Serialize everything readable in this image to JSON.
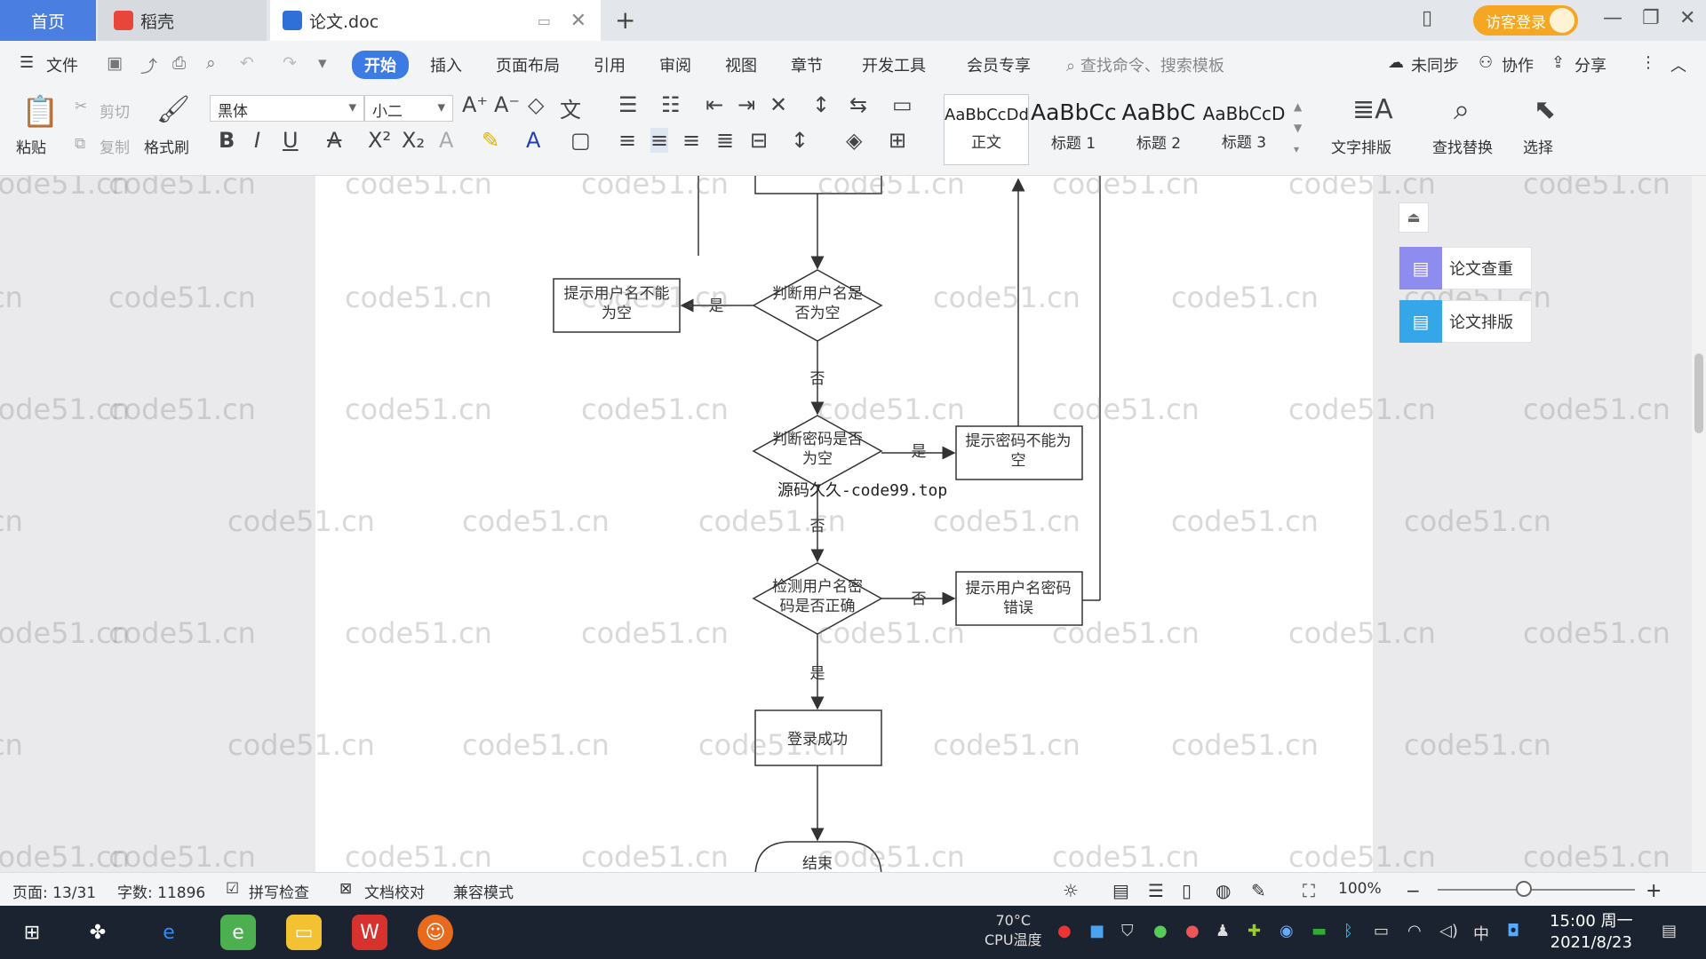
{
  "tabs": {
    "home": "首页",
    "daoke": "稻壳",
    "doc": "论文.doc",
    "guest_login": "访客登录"
  },
  "menu": {
    "file": "文件",
    "items": [
      "开始",
      "插入",
      "页面布局",
      "引用",
      "审阅",
      "视图",
      "章节",
      "开发工具",
      "会员专享"
    ],
    "search_placeholder": "查找命令、搜索模板",
    "unsynced": "未同步",
    "collaborate": "协作",
    "share": "分享"
  },
  "ribbon": {
    "paste": "粘贴",
    "cut": "剪切",
    "copy": "复制",
    "format_painter": "格式刷",
    "font_name": "黑体",
    "font_size": "小二",
    "styles": [
      {
        "preview": "AaBbCcDd",
        "label": "正文"
      },
      {
        "preview": "AaBbCc",
        "label": "标题 1"
      },
      {
        "preview": "AaBbC",
        "label": "标题 2"
      },
      {
        "preview": "AaBbCcD",
        "label": "标题 3"
      }
    ],
    "text_layout": "文字排版",
    "find_replace": "查找替换",
    "select": "选择"
  },
  "side_panel": {
    "check": "论文查重",
    "layout": "论文排版"
  },
  "flowchart": {
    "judge_user": "判断用户名是否为空",
    "judge_user_l1": "判断用户名是",
    "judge_user_l2": "否为空",
    "hint_user_l1": "提示用户名不能",
    "hint_user_l2": "为空",
    "judge_pwd_l1": "判断密码是否",
    "judge_pwd_l2": "为空",
    "hint_pwd_l1": "提示密码不能为",
    "hint_pwd_l2": "空",
    "check_l1": "检测用户名密",
    "check_l2": "码是否正确",
    "hint_err_l1": "提示用户名密码",
    "hint_err_l2": "错误",
    "success": "登录成功",
    "end_partial": "结束",
    "yes": "是",
    "no": "否"
  },
  "overlay_text": "源码久久-code99.top",
  "watermark": "code51.cn",
  "status": {
    "page": "页面: 13/31",
    "words": "字数: 11896",
    "spell": "拼写检查",
    "proof": "文档校对",
    "compat": "兼容模式",
    "zoom": "100%"
  },
  "taskbar": {
    "temp_value": "70°C",
    "temp_label": "CPU温度",
    "ime": "中",
    "time": "15:00 周一",
    "date": "2021/8/23"
  },
  "colors": {
    "accent": "#3d7be4",
    "guest": "#f5a623",
    "taskbar": "#1b2331"
  }
}
